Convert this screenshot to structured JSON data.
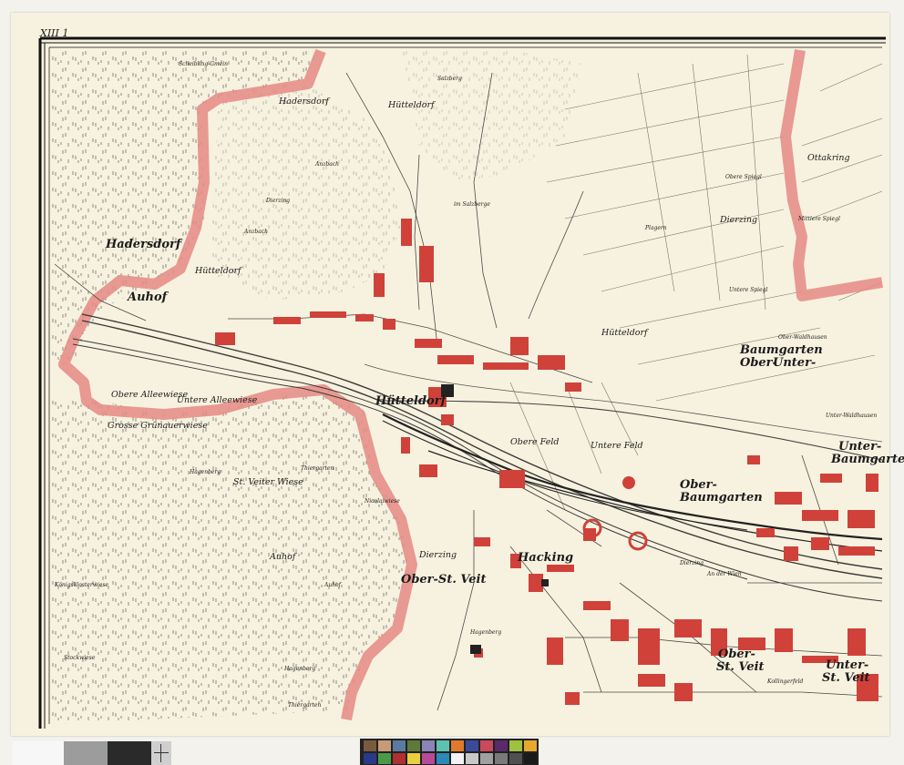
{
  "map": {
    "sheet_number": "XIII 1",
    "colors": {
      "paper": "#f7f2df",
      "boundary_band": "#e58a84",
      "buildings": "#d0413a",
      "lines": "#3a3a3a",
      "forest_marks": "#6b6b6b"
    },
    "labels": {
      "scheibling_gmein": "Scheibling-Gmein",
      "hadersdorf_1": "Hadersdorf",
      "hadersdorf_2": "Hadersdorf",
      "huetteldorf_n": "Hütteldorf",
      "salzberg": "Salzberg",
      "im_salzberge": "im Salzberge",
      "obere_spiegl": "Obere Spiegl",
      "ottakring": "Ottakring",
      "mittlere_spiegl": "Mittlere Spiegl",
      "anzbach_1": "Anzbach",
      "anzbach_2": "Anzbach",
      "dierzing_1": "Dierzing",
      "dierzing_2": "Dierzing",
      "dierzing_3": "Dierzing",
      "dierzing_4": "Dierzing",
      "huetteldorf_w": "Hütteldorf",
      "huetteldorf_e": "Hütteldorf",
      "huetteldorf_main": "Hütteldorf",
      "auhof_1": "Auhof",
      "auhof_2": "Auhof",
      "auhof_3": "Auhof",
      "plagern": "Plagern",
      "untere_spiegl": "Untere Spiegl",
      "baumgarten_ober_unter_1": "Baumgarten",
      "baumgarten_ober_unter_2": "Ober-",
      "baumgarten_ober_unter_3": "Unter-",
      "ober_waldhausen": "Ober-Waldhausen",
      "unter_waldhausen": "Unter-Waldhausen",
      "obere_alleewiese": "Obere Alleewiese",
      "untere_alleewiese": "Untere Alleewiese",
      "grosse_graenauerwiese": "Grosse Grünauerwiese",
      "hagenberg_1": "Hagenberg",
      "hagenberg_2": "Hagenberg",
      "hagenberg_3": "Hagenberg",
      "st_veiter_wiese": "St. Veiter Wiese",
      "thiergarten_1": "Thiergarten",
      "thiergarten_2": "Thiergarten",
      "nicolaiwiese": "Nicolaiwiese",
      "obere_feld": "Obere Feld",
      "untere_feld": "Untere Feld",
      "unter_baumgarten_1": "Unter-",
      "unter_baumgarten_2": "Baumgarten",
      "ober_baumgarten_1": "Ober-",
      "ober_baumgarten_2": "Baumgarten",
      "hacking": "Hacking",
      "ober_st_veit": "Ober-St. Veit",
      "ober_st_veit_2a": "Ober-",
      "ober_st_veit_2b": "St. Veit",
      "unter_st_veit_1": "Unter-",
      "unter_st_veit_2": "St. Veit",
      "koenigsklosterwiese": "Königsklosterwiese",
      "stockwiese": "Stockwiese",
      "kollingerfeld": "Kollingerfeld",
      "an_der_wien": "An der Wien"
    }
  }
}
